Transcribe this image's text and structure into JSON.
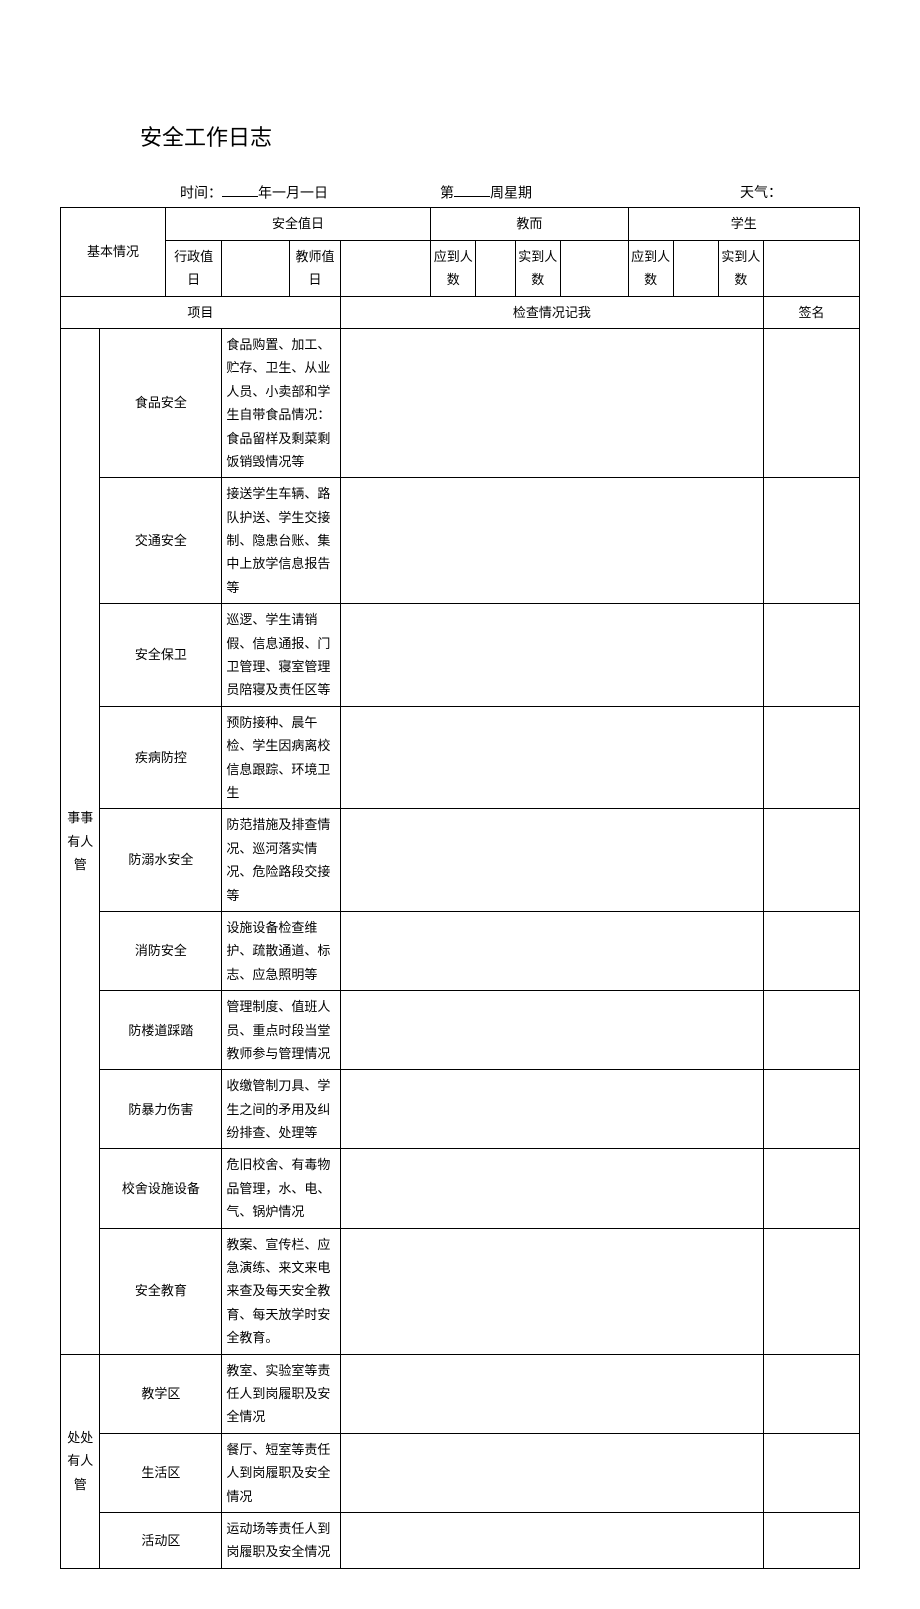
{
  "title": "安全工作日志",
  "meta": {
    "time_label": "时间：",
    "year_suffix": "年一月一日",
    "week_prefix": "第",
    "week_suffix": "周星期",
    "weather_label": "天气："
  },
  "header": {
    "basic": "基本情况",
    "duty": "安全值日",
    "teacher": "教而",
    "student": "学生",
    "admin_duty": "行政值日",
    "teacher_duty": "教师值日",
    "expected": "应到人数",
    "actual": "实到人数",
    "actual2": "实到人数",
    "project": "项目",
    "record": "检查情况记我",
    "sign": "签名"
  },
  "section1": {
    "group": "事事有人管",
    "rows": [
      {
        "cat": "食品安全",
        "desc": "食品购置、加工、贮存、卫生、从业人员、小卖部和学生自带食品情况：食品留样及剩菜剩饭销毁情况等"
      },
      {
        "cat": "交通安全",
        "desc": "接送学生车辆、路队护送、学生交接制、隐患台账、集中上放学信息报告等"
      },
      {
        "cat": "安全保卫",
        "desc": "巡逻、学生请销假、信息通报、门卫管理、寝室管理员陪寝及责任区等"
      },
      {
        "cat": "疾病防控",
        "desc": "预防接种、晨午检、学生因病离校信息跟踪、环境卫生"
      },
      {
        "cat": "防溺水安全",
        "desc": "防范措施及排查情况、巡河落实情况、危险路段交接等"
      },
      {
        "cat": "消防安全",
        "desc": "设施设备检查维护、疏散通道、标志、应急照明等"
      },
      {
        "cat": "防楼道踩踏",
        "desc": "管理制度、值班人员、重点时段当堂教师参与管理情况"
      },
      {
        "cat": "防暴力伤害",
        "desc": "收缴管制刀具、学生之间的矛用及纠纷排查、处理等"
      },
      {
        "cat": "校舍设施设备",
        "desc": "危旧校舍、有毒物品管理，水、电、气、锅炉情况"
      },
      {
        "cat": "安全教育",
        "desc": "教案、宣传栏、应急演练、来文来电来查及每天安全教育、每天放学时安全教育。"
      }
    ]
  },
  "section2": {
    "group": "处处有人管",
    "rows": [
      {
        "cat": "教学区",
        "desc": "教室、实验室等责任人到岗履职及安全情况"
      },
      {
        "cat": "生活区",
        "desc": "餐厅、短室等责任人到岗履职及安全情况"
      },
      {
        "cat": "活动区",
        "desc": "运动场等责任人到岗履职及安全情况"
      }
    ]
  }
}
